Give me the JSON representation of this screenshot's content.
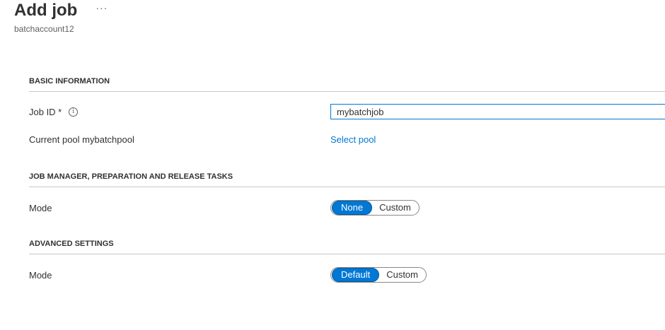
{
  "header": {
    "title": "Add job",
    "more_label": "···",
    "subtitle": "batchaccount12"
  },
  "basic": {
    "section_title": "BASIC INFORMATION",
    "job_id_label": "Job ID *",
    "info_icon_glyph": "i",
    "job_id_value": "mybatchjob",
    "pool_label": "Current pool mybatchpool",
    "select_pool_link": "Select pool"
  },
  "tasks": {
    "section_title": "JOB MANAGER, PREPARATION AND RELEASE TASKS",
    "mode_label": "Mode",
    "options": [
      "None",
      "Custom"
    ],
    "selected": "None"
  },
  "advanced": {
    "section_title": "ADVANCED SETTINGS",
    "mode_label": "Mode",
    "options": [
      "Default",
      "Custom"
    ],
    "selected": "Default"
  },
  "colors": {
    "accent": "#0078d4",
    "text": "#323130",
    "divider": "#c8c6c4"
  }
}
